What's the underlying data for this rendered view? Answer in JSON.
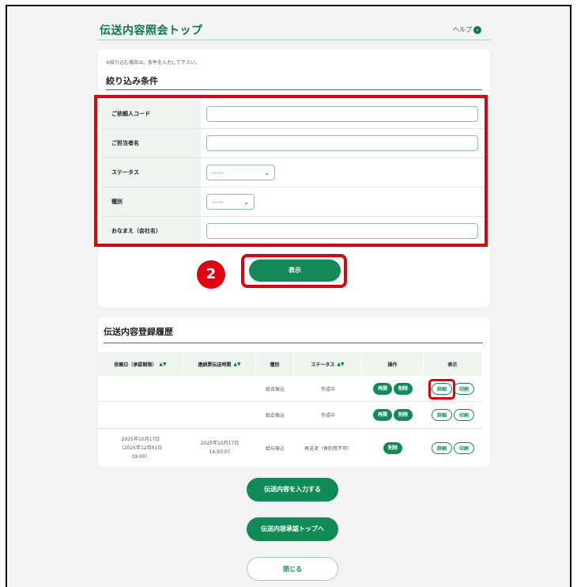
{
  "page": {
    "title": "伝送内容照会トップ",
    "help_label": "ヘルプ",
    "help_icon": "circle-chevron-right"
  },
  "filter": {
    "note": "※絞り込む場合は、条件を入力して下さい。",
    "title": "絞り込み条件",
    "fields": [
      {
        "label": "ご依頼人コード",
        "type": "text",
        "value": ""
      },
      {
        "label": "ご担当者名",
        "type": "text",
        "value": ""
      },
      {
        "label": "ステータス",
        "type": "select",
        "value": "-----"
      },
      {
        "label": "種別",
        "type": "select",
        "value": "-----"
      },
      {
        "label": "おなまえ（会社名）",
        "type": "text",
        "value": ""
      }
    ],
    "submit_label": "表示"
  },
  "step_badge": "2",
  "history": {
    "title": "伝送内容登録履歴",
    "columns": {
      "date": "依頼日（承認期限）",
      "sent": "連続票伝送時間",
      "kind": "種別",
      "status": "ステータス",
      "ops": "操作",
      "view": "表示"
    },
    "sort_arrows": "▲▼",
    "rows": [
      {
        "date": "",
        "date2": "",
        "date3": "",
        "sent": "",
        "sent2": "",
        "kind": "総合振込",
        "status": "作成中",
        "ops": [
          "再開",
          "削除"
        ],
        "view": [
          "詳細",
          "印刷"
        ]
      },
      {
        "date": "",
        "date2": "",
        "date3": "",
        "sent": "",
        "sent2": "",
        "kind": "総合振込",
        "status": "作成中",
        "ops": [
          "再開",
          "削除"
        ],
        "view": [
          "詳細",
          "印刷"
        ]
      },
      {
        "date": "2025年10月17日",
        "date2": "（2025年12月01日",
        "date3": "19:00）",
        "sent": "2025年10月17日",
        "sent2": "14:50:07",
        "kind": "給与振込",
        "status": "再送済（再利用不可）",
        "ops": [
          "削除"
        ],
        "view": [
          "詳細",
          "印刷"
        ]
      }
    ]
  },
  "actions": {
    "input_label": "伝送内容を入力する",
    "approval_label": "伝送内容承認トップへ",
    "close_label": "閉じる"
  },
  "colors": {
    "brand_green": "#128a57",
    "highlight_red": "#e0000f",
    "label_bg": "#eef5ee"
  }
}
